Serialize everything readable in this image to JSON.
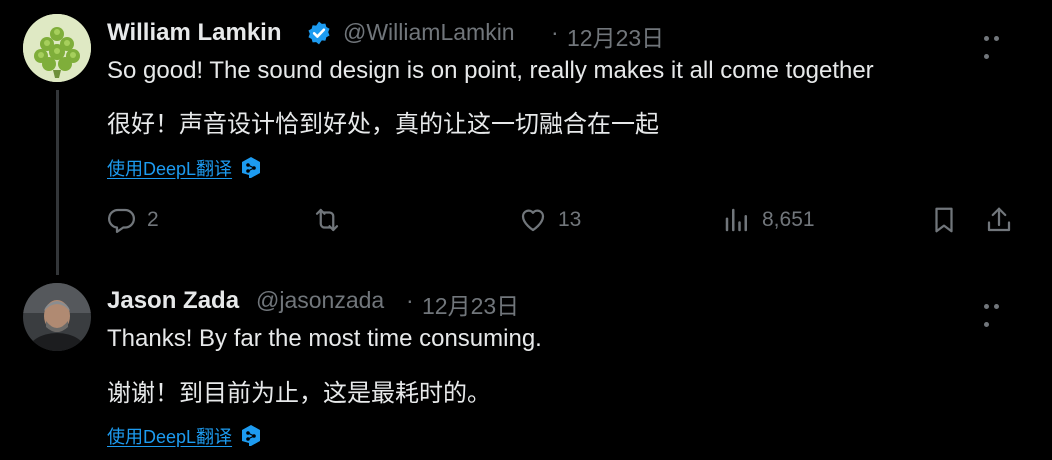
{
  "tweets": [
    {
      "author": "William Lamkin",
      "handle": "@WilliamLamkin",
      "separator": "·",
      "date": "12月23日",
      "text_en": "So good! The sound design is on point, really makes it all come together",
      "text_zh": "很好！声音设计恰到好处，真的让这一切融合在一起",
      "translate_label": "使用DeepL翻译",
      "replies": "2",
      "likes": "13",
      "views": "8,651"
    },
    {
      "author": "Jason Zada",
      "handle": "@jasonzada",
      "separator": "·",
      "date": "12月23日",
      "text_en": "Thanks! By far the most time consuming.",
      "text_zh": "谢谢！到目前为止，这是最耗时的。",
      "translate_label": "使用DeepL翻译"
    }
  ],
  "colors": {
    "background": "#000000",
    "text": "#e7e9ea",
    "muted": "#71767b",
    "link": "#1d9bf0",
    "verified": "#1d9bf0"
  },
  "icons": [
    "verified-badge-icon",
    "more-icon",
    "reply-icon",
    "retweet-icon",
    "like-icon",
    "views-icon",
    "bookmark-icon",
    "share-icon",
    "deepl-icon"
  ]
}
